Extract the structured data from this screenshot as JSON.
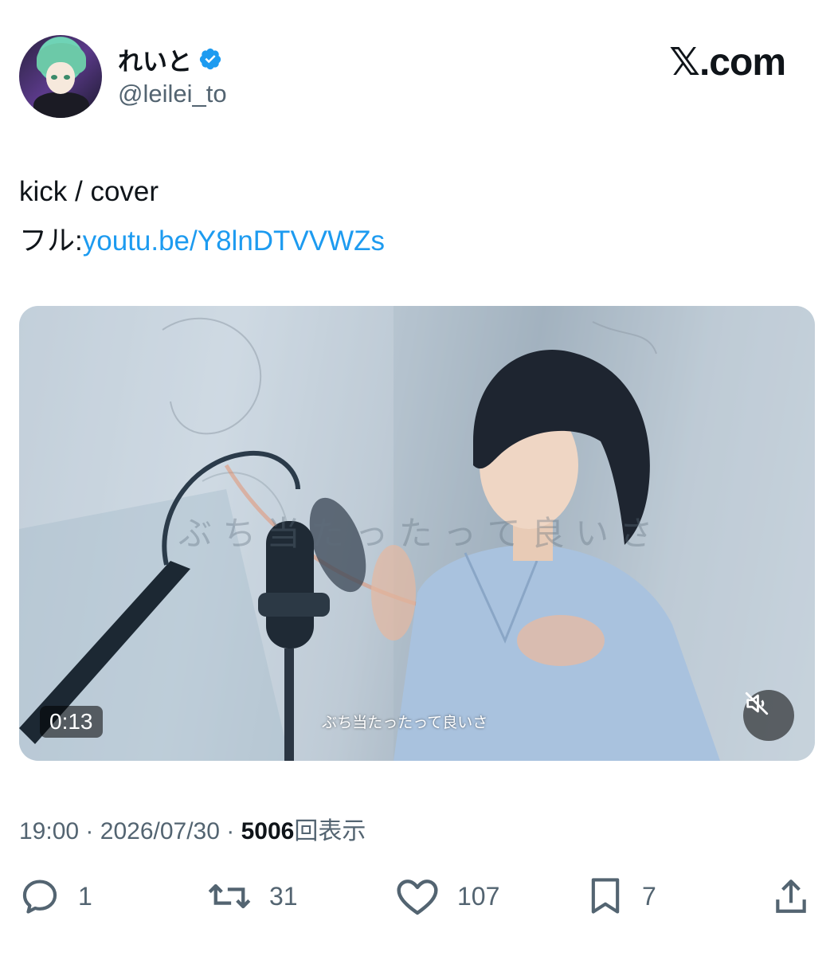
{
  "header": {
    "display_name": "れいと",
    "handle": "@leilei_to",
    "brand": "𝕏.com",
    "verified_color": "#1d9bf0"
  },
  "tweet": {
    "line1": "kick / cover",
    "line2_prefix": "フル:",
    "link_text": "youtu.be/Y8lnDTVVWZs",
    "link_color": "#1d9bf0"
  },
  "media": {
    "duration": "0:13",
    "subtitle": "ぶち当たったって良いさ",
    "mute_icon": "speaker-muted-icon"
  },
  "meta": {
    "time": "19:00",
    "separator1": "·",
    "date": "2026/07/30",
    "separator2": "·",
    "views_count": "5006",
    "views_label": "回表示"
  },
  "actions": {
    "reply": {
      "icon": "reply-icon",
      "count": "1"
    },
    "repost": {
      "icon": "repost-icon",
      "count": "31"
    },
    "like": {
      "icon": "heart-icon",
      "count": "107"
    },
    "bookmark": {
      "icon": "bookmark-icon",
      "count": "7"
    },
    "share": {
      "icon": "share-icon"
    }
  }
}
